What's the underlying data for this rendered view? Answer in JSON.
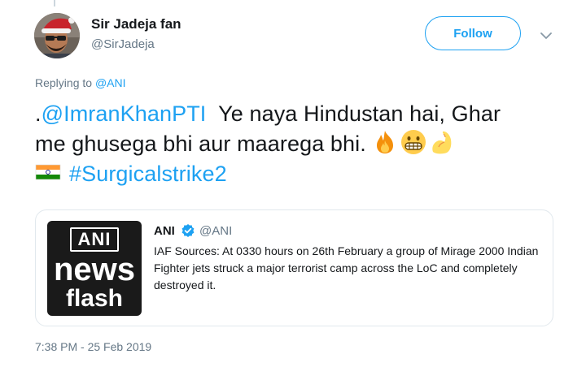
{
  "user": {
    "display_name": "Sir Jadeja fan",
    "handle": "@SirJadeja"
  },
  "actions": {
    "follow_label": "Follow"
  },
  "reply_context": {
    "prefix": "Replying to ",
    "mention": "@ANI"
  },
  "tweet": {
    "dot": ".",
    "mention": "@ImranKhanPTI",
    "line1_text": "  Ye naya Hindustan hai, Ghar",
    "line2_text": "me ghusega bhi aur maarega bhi. ",
    "hashtag": "#Surgicalstrike2",
    "emojis": [
      "fire-emoji",
      "grimacing-face-emoji",
      "flexed-biceps-emoji",
      "india-flag-emoji"
    ]
  },
  "quoted_tweet": {
    "name": "ANI",
    "handle": "@ANI",
    "text": "IAF Sources: At 0330 hours on 26th February a group of Mirage 2000 Indian Fighter jets struck a major terrorist camp across the LoC and completely destroyed it.",
    "thumbnail": {
      "top": "ANI",
      "middle": "news",
      "bottom": "flash"
    }
  },
  "timestamp": "7:38 PM - 25 Feb 2019",
  "colors": {
    "accent": "#1da1f2",
    "text": "#14171a",
    "muted": "#657786",
    "border": "#e1e8ed"
  }
}
